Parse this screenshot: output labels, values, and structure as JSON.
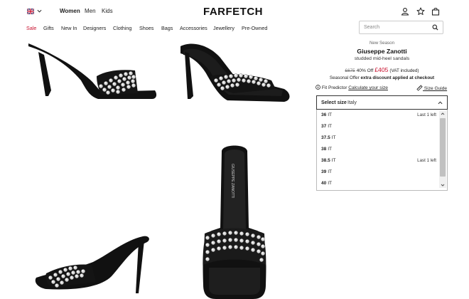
{
  "header": {
    "logo": "FARFETCH",
    "genders": [
      "Women",
      "Men",
      "Kids"
    ],
    "region_icon": "uk-flag-icon",
    "icons": [
      "account-icon",
      "wishlist-star-icon",
      "shopping-bag-icon"
    ]
  },
  "nav": {
    "items": [
      "Sale",
      "Gifts",
      "New In",
      "Designers",
      "Clothing",
      "Shoes",
      "Bags",
      "Accessories",
      "Jewellery",
      "Pre-Owned"
    ]
  },
  "search": {
    "placeholder": "Search"
  },
  "product": {
    "season": "New Season",
    "brand": "Giuseppe Zanotti",
    "name": "studded mid-heel sandals",
    "old_price": "£675",
    "discount": "40% Off",
    "new_price": "£405",
    "vat": "(VAT included)",
    "promo_prefix": "Seasonal Offer",
    "promo_bold": "extra discount applied at checkout",
    "fit_label": "Fit Predictor",
    "fit_link": "Calculate your size",
    "size_guide": "Size Guide",
    "insole_text": "GIUSEPPE ZANOTTI"
  },
  "size_select": {
    "label": "Select size",
    "value": "Italy",
    "options": [
      {
        "size": "36",
        "unit": "IT",
        "stock": "Last 1 left"
      },
      {
        "size": "37",
        "unit": "IT",
        "stock": ""
      },
      {
        "size": "37.5",
        "unit": "IT",
        "stock": ""
      },
      {
        "size": "38",
        "unit": "IT",
        "stock": ""
      },
      {
        "size": "38.5",
        "unit": "IT",
        "stock": "Last 1 left"
      },
      {
        "size": "39",
        "unit": "IT",
        "stock": ""
      },
      {
        "size": "40",
        "unit": "IT",
        "stock": ""
      }
    ]
  },
  "colors": {
    "sale": "#c8102e",
    "price": "#c8102e"
  }
}
